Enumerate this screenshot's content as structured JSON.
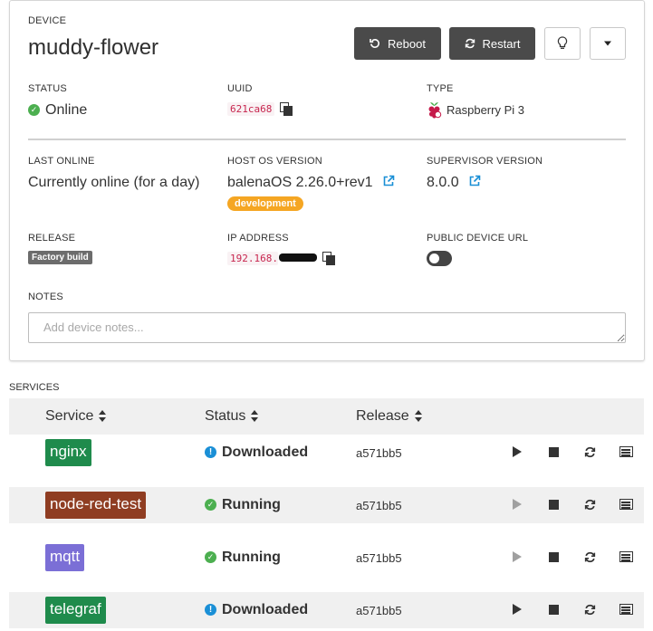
{
  "device": {
    "section_label": "DEVICE",
    "name": "muddy-flower",
    "reboot_label": "Reboot",
    "restart_label": "Restart"
  },
  "fields": {
    "status": {
      "label": "STATUS",
      "value": "Online"
    },
    "uuid": {
      "label": "UUID",
      "value": "621ca68"
    },
    "type": {
      "label": "TYPE",
      "value": "Raspberry Pi 3"
    },
    "last_online": {
      "label": "LAST ONLINE",
      "value": "Currently online (for a day)"
    },
    "host_os": {
      "label": "HOST OS VERSION",
      "value": "balenaOS 2.26.0+rev1",
      "badge": "development"
    },
    "supervisor": {
      "label": "SUPERVISOR VERSION",
      "value": "8.0.0"
    },
    "release": {
      "label": "RELEASE",
      "value": "Factory build"
    },
    "ip": {
      "label": "IP ADDRESS",
      "value": "192.168."
    },
    "public_url": {
      "label": "PUBLIC DEVICE URL",
      "enabled": false
    },
    "notes": {
      "label": "NOTES",
      "placeholder": "Add device notes..."
    }
  },
  "services": {
    "section_label": "SERVICES",
    "headers": {
      "service": "Service",
      "status": "Status",
      "release": "Release"
    },
    "rows": [
      {
        "name": "nginx",
        "color": "#1f8b4c",
        "status": "Downloaded",
        "status_kind": "info",
        "release": "a571bb5",
        "play_enabled": true
      },
      {
        "name": "node-red-test",
        "color": "#8f3d22",
        "status": "Running",
        "status_kind": "ok",
        "release": "a571bb5",
        "play_enabled": false
      },
      {
        "name": "mqtt",
        "color": "#7b6fd6",
        "status": "Running",
        "status_kind": "ok",
        "release": "a571bb5",
        "play_enabled": false
      },
      {
        "name": "telegraf",
        "color": "#1f8b4c",
        "status": "Downloaded",
        "status_kind": "info",
        "release": "a571bb5",
        "play_enabled": true
      }
    ]
  },
  "colors": {
    "accent_link": "#1a8fd6",
    "online": "#4caf50",
    "dev_badge": "#f5a623",
    "dark_button": "#4a4a4a"
  }
}
